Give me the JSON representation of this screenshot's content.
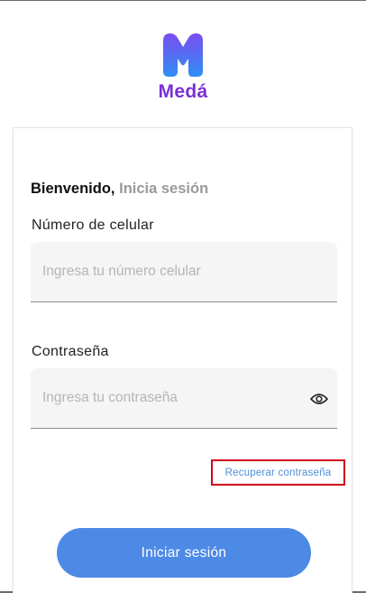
{
  "brand": {
    "name": "Medá",
    "logo_icon": "meda-m-logo",
    "colors": {
      "top": "#7b4df0",
      "bottom": "#2f8ef5",
      "text": "#7a2fd6"
    }
  },
  "login": {
    "welcome_strong": "Bienvenido,",
    "welcome_soft": "Inicia sesión",
    "phone": {
      "label": "Número de celular",
      "placeholder": "Ingresa tu número celular"
    },
    "password": {
      "label": "Contraseña",
      "placeholder": "Ingresa tu contraseña",
      "toggle_icon": "eye-icon"
    },
    "recover_link": "Recuperar contraseña",
    "submit_label": "Iniciar sesión"
  },
  "colors": {
    "primary_button": "#4d8ae6",
    "link": "#4e8fd9",
    "highlight_border": "#d0021b",
    "field_background": "#f5f5f5"
  }
}
